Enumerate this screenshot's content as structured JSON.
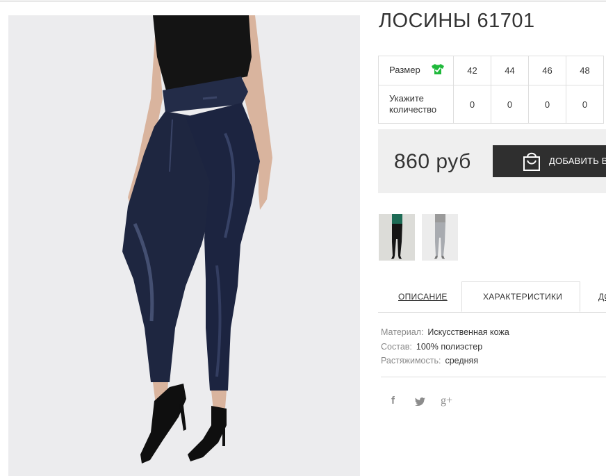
{
  "product": {
    "title": "ЛОСИНЫ 61701",
    "price": "860 руб",
    "add_to_cart_label": "ДОБАВИТЬ В"
  },
  "size_table": {
    "size_label": "Размер",
    "quantity_label": "Укажите количество",
    "sizes": [
      "42",
      "44",
      "46",
      "48"
    ],
    "quantities": [
      "0",
      "0",
      "0",
      "0"
    ]
  },
  "tabs": [
    {
      "label": "ОПИСАНИЕ"
    },
    {
      "label": "ХАРАКТЕРИСТИКИ"
    },
    {
      "label": "ДО"
    }
  ],
  "specs": [
    {
      "label": "Материал:",
      "value": "Искусственная кожа"
    },
    {
      "label": "Состав:",
      "value": "100% полиэстер"
    },
    {
      "label": "Растяжимость:",
      "value": "средняя"
    }
  ],
  "social": {
    "facebook": "f",
    "google": "g+"
  },
  "colors": {
    "button_bg": "#2f2f2f",
    "price_box_bg": "#efefef",
    "size_icon": "#1fb93b",
    "leggings": "#1e2640"
  },
  "icons": [
    "shirt-check-icon",
    "shopping-bag-icon",
    "facebook-icon",
    "twitter-icon",
    "google-plus-icon"
  ]
}
